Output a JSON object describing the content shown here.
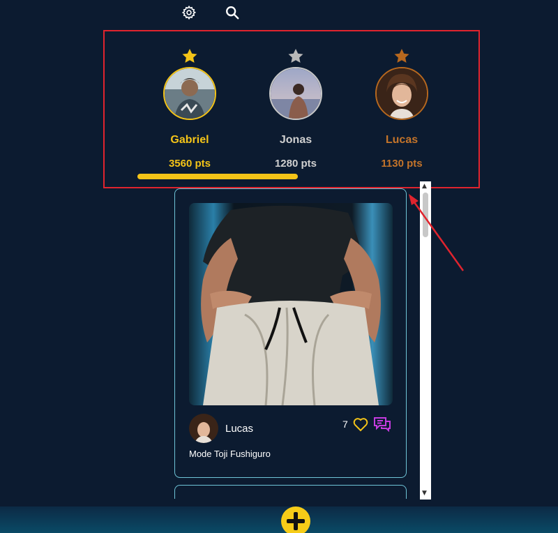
{
  "leaderboard": [
    {
      "rank": 1,
      "name": "Gabriel",
      "points": "3560 pts",
      "color": "#f4c418"
    },
    {
      "rank": 2,
      "name": "Jonas",
      "points": "1280 pts",
      "color": "#c8c8c8"
    },
    {
      "rank": 3,
      "name": "Lucas",
      "points": "1130 pts",
      "color": "#c4742a"
    }
  ],
  "post": {
    "author": "Lucas",
    "like_count": "7",
    "caption": "Mode Toji Fushiguro"
  },
  "icons": {
    "settings": "gear-icon",
    "search": "search-icon",
    "like": "heart-icon",
    "comment": "comment-icon",
    "add": "plus-icon"
  },
  "colors": {
    "background": "#0c1b30",
    "gold": "#f4c418",
    "silver": "#c8c8c8",
    "bronze": "#c4742a",
    "card_border": "#6fc5d8",
    "highlight_frame": "#e0242e",
    "comment_accent": "#c53be0"
  }
}
